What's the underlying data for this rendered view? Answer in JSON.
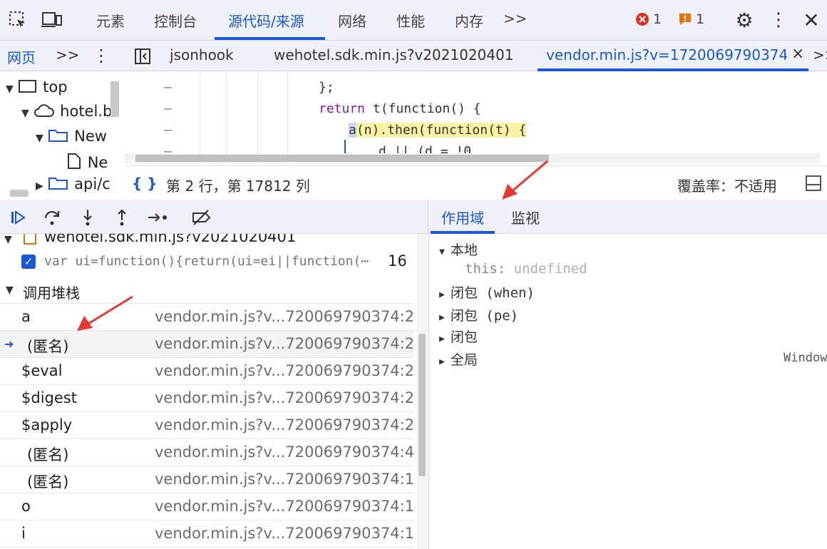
{
  "top_tabs": {
    "elements": "元素",
    "console": "控制台",
    "sources": "源代码/来源",
    "network": "网络",
    "performance": "性能",
    "memory": "内存",
    "more": ">>"
  },
  "status_counts": {
    "errors": "1",
    "warnings": "1"
  },
  "file_tabs": {
    "page": "网页",
    "more": ">>",
    "jsonhook": "jsonhook",
    "wehotel": "wehotel.sdk.min.js?v2021020401",
    "vendor": "vendor.min.js?v=1720069790374",
    "close": "×",
    "overflow": ">>"
  },
  "tree": {
    "top": "top",
    "host": "hotel.b",
    "folder": "New",
    "file": "Ne",
    "api": "api/c"
  },
  "code_lines": {
    "l1": "};",
    "l2_kw": "return",
    "l2_rest": " t(function() {",
    "l3_call": "a",
    "l3_rest": "(n).then(function(t) {",
    "l4": "d || (d = !0"
  },
  "status_line": {
    "braces": "{ }",
    "position": "第 2 行，第 17812 列",
    "coverage": "覆盖率：不适用"
  },
  "scope_tabs": {
    "scope": "作用域",
    "watch": "监视"
  },
  "breakpoints": {
    "file": "wehotel.sdk.min.js?v2021020401",
    "code": "var ui=function(){return(ui=ei||function(⋯",
    "line": "16"
  },
  "call_stack": {
    "title": "调用堆栈",
    "frames": [
      {
        "fn": "a",
        "loc": "vendor.min.js?v...720069790374:2"
      },
      {
        "fn": "(匿名)",
        "loc": "vendor.min.js?v...720069790374:2"
      },
      {
        "fn": "$eval",
        "loc": "vendor.min.js?v...720069790374:2"
      },
      {
        "fn": "$digest",
        "loc": "vendor.min.js?v...720069790374:2"
      },
      {
        "fn": "$apply",
        "loc": "vendor.min.js?v...720069790374:2"
      },
      {
        "fn": "(匿名)",
        "loc": "vendor.min.js?v...720069790374:4"
      },
      {
        "fn": "(匿名)",
        "loc": "vendor.min.js?v...720069790374:1"
      },
      {
        "fn": "o",
        "loc": "vendor.min.js?v...720069790374:1"
      },
      {
        "fn": "i",
        "loc": "vendor.min.js?v...720069790374:1"
      }
    ]
  },
  "scope": {
    "local": "本地",
    "this_key": "this:",
    "this_val": "undefined",
    "closure_when": "闭包 (when)",
    "closure_pe": "闭包 (pe)",
    "closure": "闭包",
    "global": "全局",
    "global_val": "Window"
  },
  "colors": {
    "accent": "#1a57d6",
    "highlight": "#fbf2a3",
    "error": "#d93025",
    "warning": "#e8710a",
    "annotation_arrow": "#e53935"
  }
}
